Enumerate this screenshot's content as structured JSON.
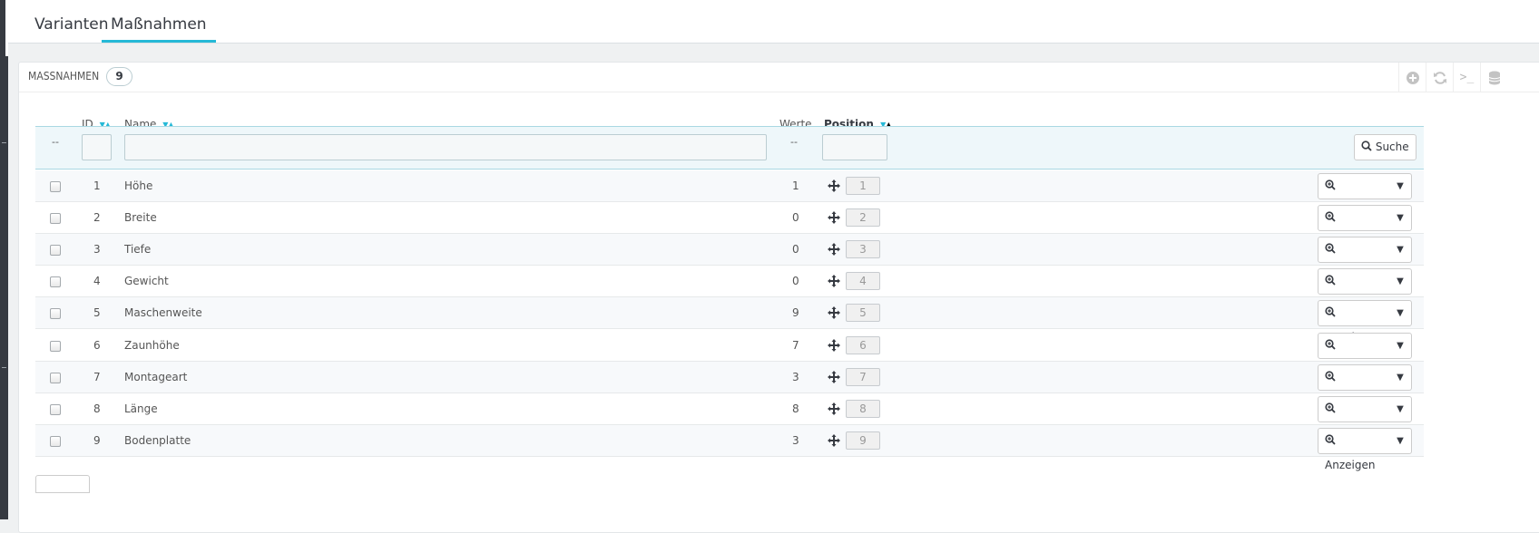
{
  "tabs": [
    "Varianten",
    "Maßnahmen"
  ],
  "panel": {
    "title": "MASSNAHMEN",
    "count": "9"
  },
  "columns": {
    "id": "ID",
    "name": "Name",
    "werte": "Werte",
    "position": "Position"
  },
  "filter": {
    "dash": "--",
    "search_label": "Suche"
  },
  "action_label": "Anzeigen",
  "icons": {
    "add": "plus-circle-icon",
    "refresh": "refresh-icon",
    "sql": "terminal-icon",
    "export": "database-icon",
    "search": "magnifier-icon",
    "view": "zoom-in-icon",
    "drag": "move-arrows-icon",
    "caret": "caret-down-icon"
  },
  "colors": {
    "accent": "#25b9d7",
    "sidebar": "#363a41"
  },
  "rows": [
    {
      "id": "1",
      "name": "Höhe",
      "werte": "1",
      "position": "1"
    },
    {
      "id": "2",
      "name": "Breite",
      "werte": "0",
      "position": "2"
    },
    {
      "id": "3",
      "name": "Tiefe",
      "werte": "0",
      "position": "3"
    },
    {
      "id": "4",
      "name": "Gewicht",
      "werte": "0",
      "position": "4"
    },
    {
      "id": "5",
      "name": "Maschenweite",
      "werte": "9",
      "position": "5"
    },
    {
      "id": "6",
      "name": "Zaunhöhe",
      "werte": "7",
      "position": "6"
    },
    {
      "id": "7",
      "name": "Montageart",
      "werte": "3",
      "position": "7"
    },
    {
      "id": "8",
      "name": "Länge",
      "werte": "8",
      "position": "8"
    },
    {
      "id": "9",
      "name": "Bodenplatte",
      "werte": "3",
      "position": "9"
    }
  ]
}
